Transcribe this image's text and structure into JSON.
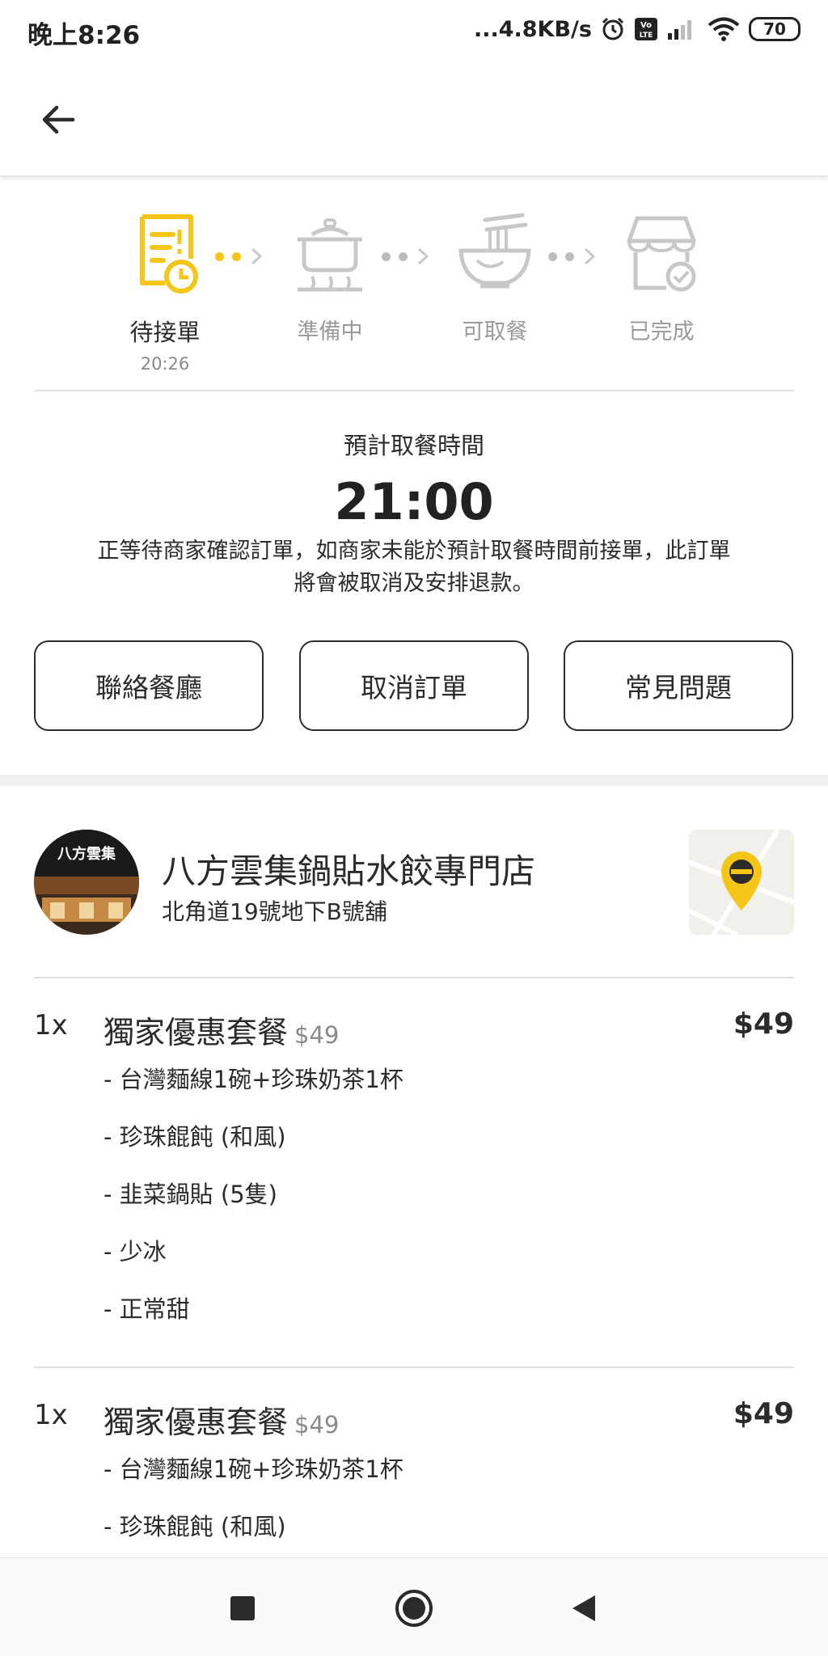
{
  "status_bar": {
    "time": "晚上8:26",
    "speed": "...4.8KB/s",
    "battery": "70",
    "icons": [
      "alarm-icon",
      "volte-icon",
      "signal-icon",
      "wifi-icon",
      "battery-icon"
    ]
  },
  "app_bar": {
    "back_icon": "arrow-left-icon"
  },
  "steps": [
    {
      "label": "待接單",
      "time": "20:26",
      "icon": "order-receipt-clock-icon",
      "active": true
    },
    {
      "label": "準備中",
      "time": "",
      "icon": "cooking-pot-icon",
      "active": false
    },
    {
      "label": "可取餐",
      "time": "",
      "icon": "noodle-bowl-icon",
      "active": false
    },
    {
      "label": "已完成",
      "time": "",
      "icon": "store-check-icon",
      "active": false
    }
  ],
  "pickup": {
    "label": "預計取餐時間",
    "time": "21:00",
    "note_line1": "正等待商家確認訂單，如商家未能於預計取餐時間前接單，此訂單",
    "note_line2": "將會被取消及安排退款。"
  },
  "actions": {
    "contact": "聯絡餐廳",
    "cancel": "取消訂單",
    "faq": "常見問題"
  },
  "restaurant": {
    "name": "八方雲集鍋貼水餃專門店",
    "address": "北角道19號地下B號舖",
    "logo_text": "八方雲集",
    "map_icon": "map-pin-icon"
  },
  "items": [
    {
      "qty": "1x",
      "name": "獨家優惠套餐",
      "unit_price": "$49",
      "total": "$49",
      "options": [
        "- 台灣麵線1碗+珍珠奶茶1杯",
        "- 珍珠餛飩 (和風)",
        "- 韭菜鍋貼  (5隻)",
        "- 少冰",
        "- 正常甜"
      ]
    },
    {
      "qty": "1x",
      "name": "獨家優惠套餐",
      "unit_price": "$49",
      "total": "$49",
      "options": [
        "- 台灣麵線1碗+珍珠奶茶1杯",
        "- 珍珠餛飩 (和風)"
      ]
    }
  ],
  "nav": {
    "recents": "square-icon",
    "home": "circle-icon",
    "back": "triangle-back-icon"
  },
  "colors": {
    "accent": "#f5c518",
    "text": "#2b2b2b",
    "muted": "#9a9a9a",
    "divider": "#e0e0e0"
  }
}
